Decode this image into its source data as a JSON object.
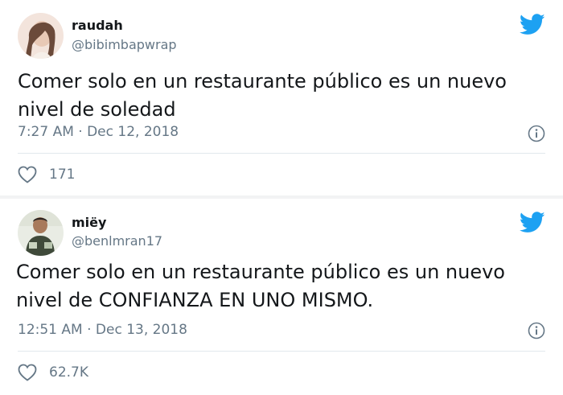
{
  "colors": {
    "twitter_blue": "#1da1f2",
    "secondary_text": "#657786",
    "primary_text": "#14171a",
    "divider": "#e1e8ed"
  },
  "tweets": [
    {
      "display_name": "raudah",
      "handle": "@bibimbapwrap",
      "text_line1": "Comer solo en un restaurante público es un nuevo",
      "text_line2": "nivel de soledad",
      "timestamp": "7:27 AM · Dec 12, 2018",
      "likes": "171",
      "icons": [
        "avatar",
        "twitter-bird-icon",
        "info-icon",
        "heart-icon"
      ]
    },
    {
      "display_name": "miëy",
      "handle": "@benlmran17",
      "text_line1": "Comer solo en un restaurante público es un nuevo",
      "text_line2": "nivel de CONFIANZA EN UNO MISMO.",
      "timestamp": "12:51 AM · Dec 13, 2018",
      "likes": "62.7K",
      "icons": [
        "avatar",
        "twitter-bird-icon",
        "info-icon",
        "heart-icon"
      ]
    }
  ]
}
